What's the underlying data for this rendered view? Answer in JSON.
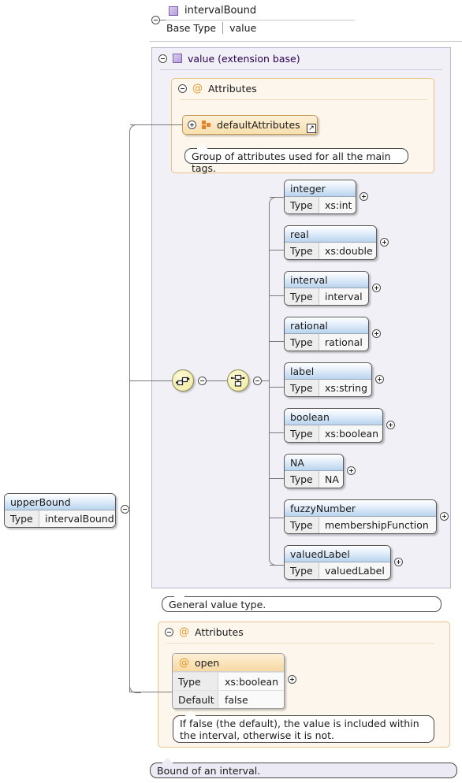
{
  "diagram": {
    "type": "xml-schema-element-diagram",
    "root": {
      "name": "intervalBound",
      "base_type_label": "Base Type",
      "base_type_value": "value",
      "icon": "element-icon",
      "toggle": "collapse-icon"
    },
    "left_element": {
      "name": "upperBound",
      "type_label": "Type",
      "type_value": "intervalBound",
      "toggle": "collapse-icon"
    },
    "extension": {
      "header": "value (extension base)",
      "icon": "element-icon",
      "toggle": "collapse-icon",
      "annotation": "General value type."
    },
    "attributes_top": {
      "header": "Attributes",
      "at_glyph": "@",
      "toggle": "collapse-icon",
      "group_ref": {
        "name": "defaultAttributes",
        "icon": "attribute-group-icon",
        "toggle": "expand-icon",
        "ref_arrow": "↗"
      },
      "annotation": "Group of attributes used for all the main tags."
    },
    "compositors": [
      {
        "name": "sequence",
        "icon": "sequence-icon",
        "toggle": "collapse-icon"
      },
      {
        "name": "choice",
        "icon": "choice-icon",
        "toggle": "collapse-icon"
      }
    ],
    "choice_children": [
      {
        "name": "integer",
        "type_label": "Type",
        "type_value": "xs:int",
        "toggle": "expand-icon"
      },
      {
        "name": "real",
        "type_label": "Type",
        "type_value": "xs:double",
        "toggle": "expand-icon"
      },
      {
        "name": "interval",
        "type_label": "Type",
        "type_value": "interval",
        "toggle": "expand-icon"
      },
      {
        "name": "rational",
        "type_label": "Type",
        "type_value": "rational",
        "toggle": "expand-icon"
      },
      {
        "name": "label",
        "type_label": "Type",
        "type_value": "xs:string",
        "toggle": "expand-icon"
      },
      {
        "name": "boolean",
        "type_label": "Type",
        "type_value": "xs:boolean",
        "toggle": "expand-icon"
      },
      {
        "name": "NA",
        "type_label": "Type",
        "type_value": "NA",
        "toggle": "expand-icon"
      },
      {
        "name": "fuzzyNumber",
        "type_label": "Type",
        "type_value": "membershipFunction",
        "toggle": "expand-icon"
      },
      {
        "name": "valuedLabel",
        "type_label": "Type",
        "type_value": "valuedLabel",
        "toggle": "expand-icon"
      }
    ],
    "attributes_bottom": {
      "header": "Attributes",
      "at_glyph": "@",
      "toggle": "collapse-icon",
      "attribute": {
        "name": "open",
        "at_glyph": "@",
        "type_label": "Type",
        "type_value": "xs:boolean",
        "default_label": "Default",
        "default_value": "false",
        "toggle": "expand-icon"
      },
      "annotation": "If false (the default), the value is included within the interval, otherwise it is not."
    },
    "root_annotation": "Bound of an interval.",
    "colors": {
      "element_accent": "#b79ddc",
      "attribute_accent": "#e8982a",
      "compositor_fill": "#f4eeae",
      "panel_fill": "#f2f0f7",
      "attr_panel_fill": "#fdf6ec",
      "node_title_gradient_end": "#b9d4ef",
      "line": "#7a7a7a"
    }
  }
}
